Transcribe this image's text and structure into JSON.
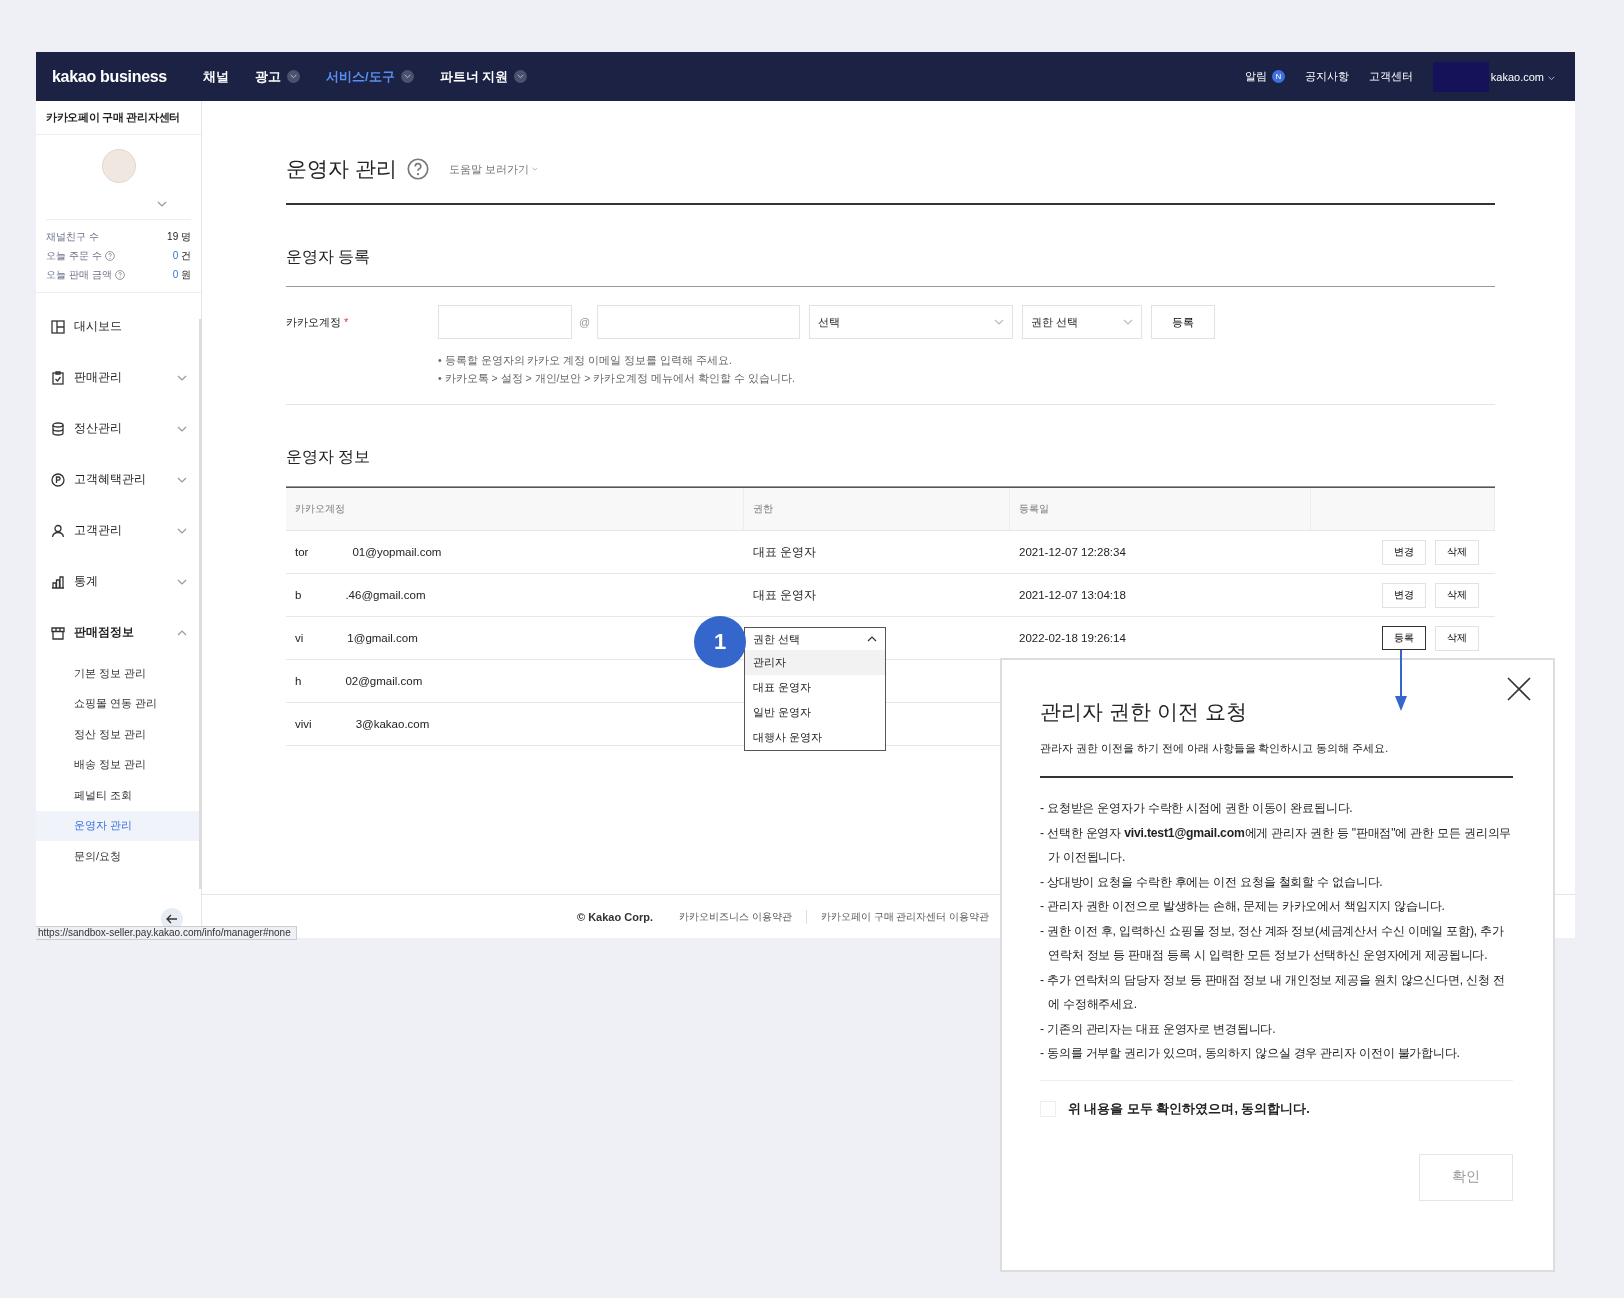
{
  "header": {
    "logo": "kakao business",
    "nav": [
      {
        "label": "채널",
        "dropdown": false,
        "selected": false
      },
      {
        "label": "광고",
        "dropdown": true,
        "selected": false
      },
      {
        "label": "서비스/도구",
        "dropdown": true,
        "selected": true
      },
      {
        "label": "파트너 지원",
        "dropdown": true,
        "selected": false
      }
    ],
    "notice": {
      "label": "알림",
      "badge": "N"
    },
    "links": [
      "공지사항",
      "고객센터"
    ],
    "account": "kakao.com"
  },
  "sidebar": {
    "title": "카카오페이 구매 관리자센터",
    "stats": [
      {
        "label": "채널친구 수",
        "help": false,
        "value": "19",
        "unit": "명",
        "highlight": false
      },
      {
        "label": "오늘 주문 수",
        "help": true,
        "value": "0",
        "unit": "건",
        "highlight": true
      },
      {
        "label": "오늘 판매 금액",
        "help": true,
        "value": "0",
        "unit": "원",
        "highlight": true
      }
    ],
    "menu": [
      {
        "label": "대시보드",
        "expandable": false
      },
      {
        "label": "판매관리",
        "expandable": true,
        "expanded": false
      },
      {
        "label": "정산관리",
        "expandable": true,
        "expanded": false
      },
      {
        "label": "고객혜택관리",
        "expandable": true,
        "expanded": false
      },
      {
        "label": "고객관리",
        "expandable": true,
        "expanded": false
      },
      {
        "label": "통계",
        "expandable": true,
        "expanded": false
      },
      {
        "label": "판매점정보",
        "expandable": true,
        "expanded": true,
        "children": [
          {
            "label": "기본 정보 관리",
            "selected": false
          },
          {
            "label": "쇼핑몰 연동 관리",
            "selected": false
          },
          {
            "label": "정산 정보 관리",
            "selected": false
          },
          {
            "label": "배송 정보 관리",
            "selected": false
          },
          {
            "label": "페널티 조회",
            "selected": false
          },
          {
            "label": "운영자 관리",
            "selected": true
          },
          {
            "label": "문의/요청",
            "selected": false
          }
        ]
      }
    ]
  },
  "page": {
    "title": "운영자 관리",
    "help_link": "도움말 보러가기"
  },
  "register": {
    "title": "운영자 등록",
    "label": "카카오계정",
    "required": "*",
    "at": "@",
    "domain_select": "선택",
    "role_select": "권한 선택",
    "button": "등록",
    "hints": [
      "• 등록할 운영자의 카카오 계정 이메일 정보를 입력해 주세요.",
      "• 카카오톡 > 설정 > 개인/보안 > 카카오계정 메뉴에서 확인할 수 있습니다."
    ]
  },
  "operators": {
    "title": "운영자 정보",
    "columns": [
      "카카오계정",
      "권한",
      "등록일"
    ],
    "rows": [
      {
        "account_start": "tor",
        "account_end": "01@yopmail.com",
        "role": "대표 운영자",
        "date": "2021-12-07 12:28:34",
        "actions": [
          {
            "label": "변경",
            "focused": false
          },
          {
            "label": "삭제",
            "focused": false
          }
        ]
      },
      {
        "account_start": "b",
        "account_end": ".46@gmail.com",
        "role": "대표 운영자",
        "date": "2021-12-07 13:04:18",
        "actions": [
          {
            "label": "변경",
            "focused": false
          },
          {
            "label": "삭제",
            "focused": false
          }
        ]
      },
      {
        "account_start": "vi",
        "account_end": "1@gmail.com",
        "role_select": {
          "placeholder": "권한 선택",
          "expanded": true,
          "options": [
            {
              "label": "관리자",
              "selected": true
            },
            {
              "label": "대표 운영자",
              "selected": false
            },
            {
              "label": "일반 운영자",
              "selected": false
            },
            {
              "label": "대행사 운영자",
              "selected": false
            }
          ]
        },
        "date": "2022-02-18 19:26:14",
        "actions": [
          {
            "label": "등록",
            "focused": true
          },
          {
            "label": "삭제",
            "focused": false
          }
        ]
      },
      {
        "account_start": "h",
        "account_end": "02@gmail.com"
      },
      {
        "account_start": "vivi",
        "account_end": "3@kakao.com"
      }
    ]
  },
  "callout": "1",
  "footer": {
    "copyright": "© Kakao Corp.",
    "links": [
      "카카오비즈니스 이용약관",
      "카카오페이 구매 관리자센터 이용약관"
    ]
  },
  "status_url": "https://sandbox-seller.pay.kakao.com/info/manager#none",
  "modal": {
    "title": "관리자 권한 이전 요청",
    "subtitle": "관라자 권한 이전을 하기 전에 아래 사항들을 확인하시고 동의해 주세요.",
    "items": [
      "- 요청받은 운영자가 수락한 시점에 권한 이동이 완료됩니다.",
      "- 선택한 운영자 **vivi.test1@gmail.com**에게 관리자 권한 등 \"판매점\"에 관한 모든 권리의무가 이전됩니다.",
      "- 상대방이 요청을 수락한 후에는 이전 요청을 철회할 수 없습니다.",
      "- 관리자 권한 이전으로 발생하는 손해, 문제는 카카오에서 책임지지 않습니다.",
      "- 권한 이전 후, 입력하신 쇼핑몰 정보, 정산 계좌 정보(세금계산서 수신 이메일 포함), 추가 연락처 정보 등 판매점 등록 시 입력한 모든 정보가 선택하신 운영자에게 제공됩니다.",
      "- 추가 연락처의 담당자 정보 등 판매점 정보 내 개인정보 제공을 원치 않으신다면, 신청 전에 수정해주세요.",
      "- 기존의 관리자는 대표 운영자로 변경됩니다.",
      "- 동의를 거부할 권리가 있으며, 동의하지 않으실 경우 관리자 이전이 불가합니다."
    ],
    "agree": {
      "label": "위 내용을 모두 확인하였으며, 동의합니다.",
      "checked": false
    },
    "confirm": {
      "label": "확인",
      "disabled": true
    }
  }
}
